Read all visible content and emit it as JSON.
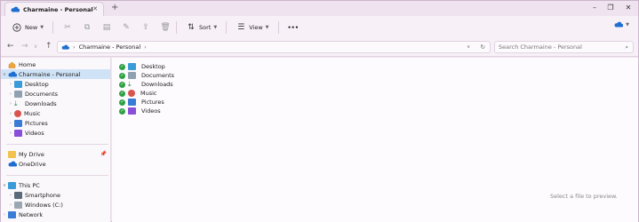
{
  "tab": {
    "title": "Charmaine - Personal"
  },
  "toolbar": {
    "new_label": "New",
    "sort_label": "Sort",
    "view_label": "View",
    "more_label": "•••"
  },
  "address": {
    "crumb": "Charmaine - Personal",
    "search_placeholder": "Search Charmaine - Personal"
  },
  "sidebar": {
    "home": "Home",
    "onedrive_personal": "Charmaine - Personal",
    "desktop": "Desktop",
    "documents": "Documents",
    "downloads": "Downloads",
    "music": "Music",
    "pictures": "Pictures",
    "videos": "Videos",
    "mydrive": "My Drive",
    "onedrive": "OneDrive",
    "thispc": "This PC",
    "smartphone": "Smartphone",
    "windows_c": "Windows (C:)",
    "network": "Network"
  },
  "files": [
    {
      "name": "Desktop",
      "icon": "desktop-folder-icon",
      "color": "#3a9bd9"
    },
    {
      "name": "Documents",
      "icon": "documents-folder-icon",
      "color": "#7a8a9a"
    },
    {
      "name": "Downloads",
      "icon": "downloads-folder-icon",
      "color": "#2d8a4e"
    },
    {
      "name": "Music",
      "icon": "music-folder-icon",
      "color": "#d9534f"
    },
    {
      "name": "Pictures",
      "icon": "pictures-folder-icon",
      "color": "#3a7bd5"
    },
    {
      "name": "Videos",
      "icon": "videos-folder-icon",
      "color": "#8a4fd9"
    }
  ],
  "preview": {
    "text": "Select a file to preview."
  }
}
